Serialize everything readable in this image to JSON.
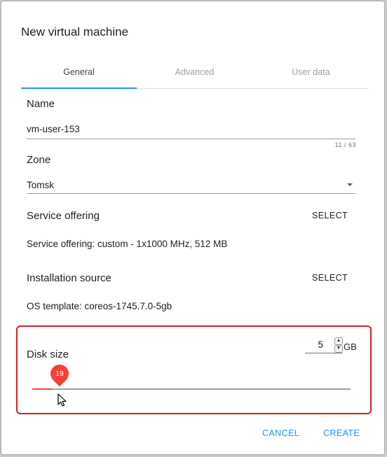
{
  "dialog": {
    "title": "New virtual machine"
  },
  "tabs": [
    {
      "label": "General",
      "active": true
    },
    {
      "label": "Advanced",
      "active": false
    },
    {
      "label": "User data",
      "active": false
    }
  ],
  "name_field": {
    "label": "Name",
    "value": "vm-user-153",
    "counter": "11 / 63"
  },
  "zone_field": {
    "label": "Zone",
    "value": "Tomsk"
  },
  "service_offering": {
    "label": "Service offering",
    "select_label": "SELECT",
    "description": "Service offering: custom - 1x1000 MHz, 512 MB"
  },
  "installation_source": {
    "label": "Installation source",
    "select_label": "SELECT",
    "description": "OS template: coreos-1745.7.0-5gb"
  },
  "disk_size": {
    "label": "Disk size",
    "input_value": "5",
    "unit": "GB",
    "slider_value": "19",
    "slider_fraction": 0.06
  },
  "actions": {
    "cancel_label": "CANCEL",
    "create_label": "CREATE"
  },
  "colors": {
    "accent": "#2196f3",
    "slider": "#f44336",
    "highlight_border": "#d11f1f"
  }
}
